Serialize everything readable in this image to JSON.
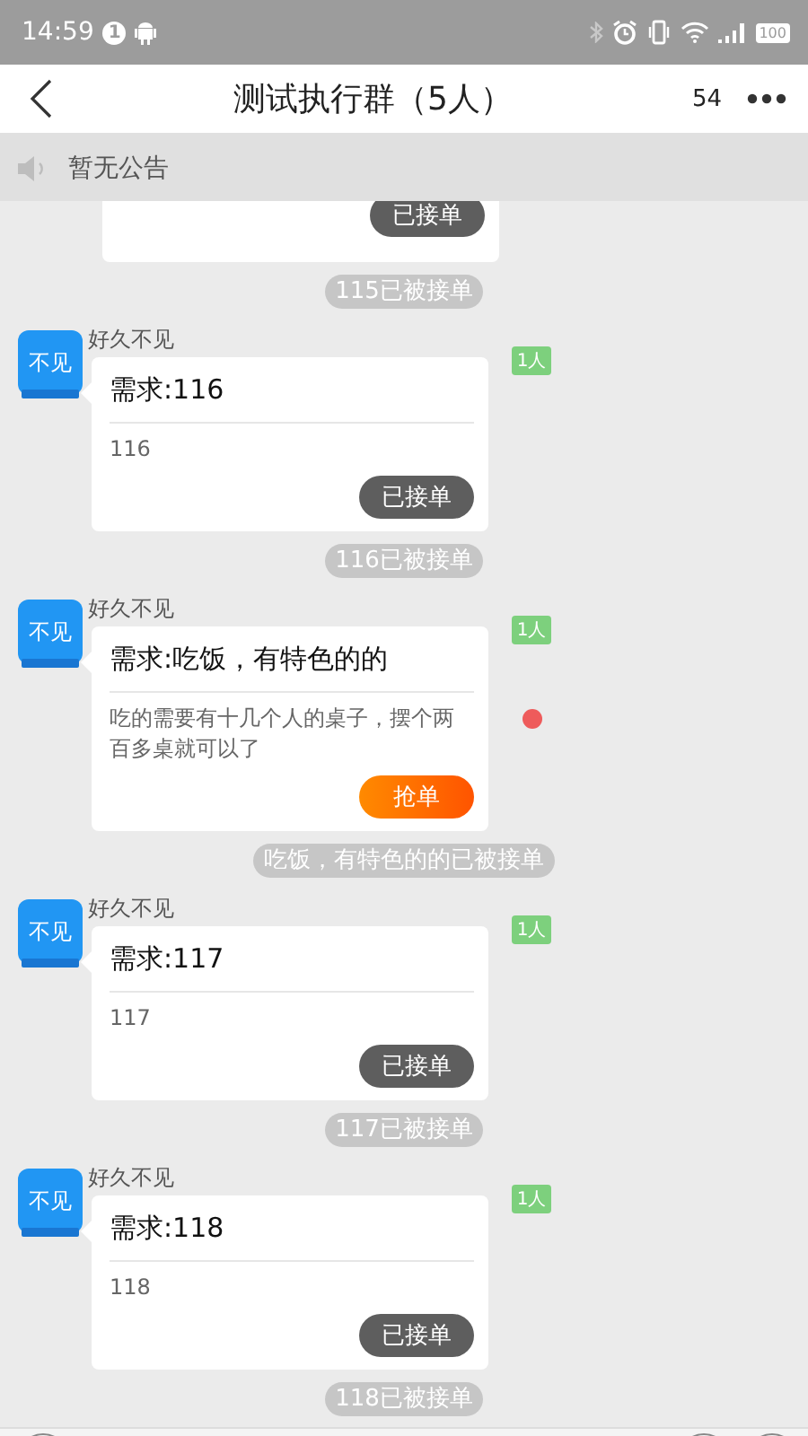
{
  "status_bar": {
    "time": "14:59",
    "notification_count": "1",
    "battery": "100"
  },
  "header": {
    "title": "测试执行群（5人）",
    "count": "54"
  },
  "announcement": {
    "text": "暂无公告"
  },
  "feed": [
    {
      "kind": "card_stub",
      "button": {
        "label": "已接单",
        "kind": "taken"
      }
    },
    {
      "kind": "notice",
      "text": "115已被接单"
    },
    {
      "kind": "message",
      "sender": "好久不见",
      "avatar_text": "不见",
      "title": "需求:116",
      "description": "116",
      "button": {
        "label": "已接单",
        "kind": "taken"
      },
      "badge": "1人",
      "unread": false
    },
    {
      "kind": "notice",
      "text": "116已被接单"
    },
    {
      "kind": "message",
      "sender": "好久不见",
      "avatar_text": "不见",
      "title": "需求:吃饭，有特色的的",
      "description": "吃的需要有十几个人的桌子，摆个两百多桌就可以了",
      "button": {
        "label": "抢单",
        "kind": "grab"
      },
      "badge": "1人",
      "unread": true
    },
    {
      "kind": "notice",
      "text": "吃饭，有特色的的已被接单"
    },
    {
      "kind": "message",
      "sender": "好久不见",
      "avatar_text": "不见",
      "title": "需求:117",
      "description": "117",
      "button": {
        "label": "已接单",
        "kind": "taken"
      },
      "badge": "1人",
      "unread": false
    },
    {
      "kind": "notice",
      "text": "117已被接单"
    },
    {
      "kind": "message",
      "sender": "好久不见",
      "avatar_text": "不见",
      "title": "需求:118",
      "description": "118",
      "button": {
        "label": "已接单",
        "kind": "taken"
      },
      "badge": "1人",
      "unread": false
    },
    {
      "kind": "notice",
      "text": "118已被接单"
    }
  ]
}
